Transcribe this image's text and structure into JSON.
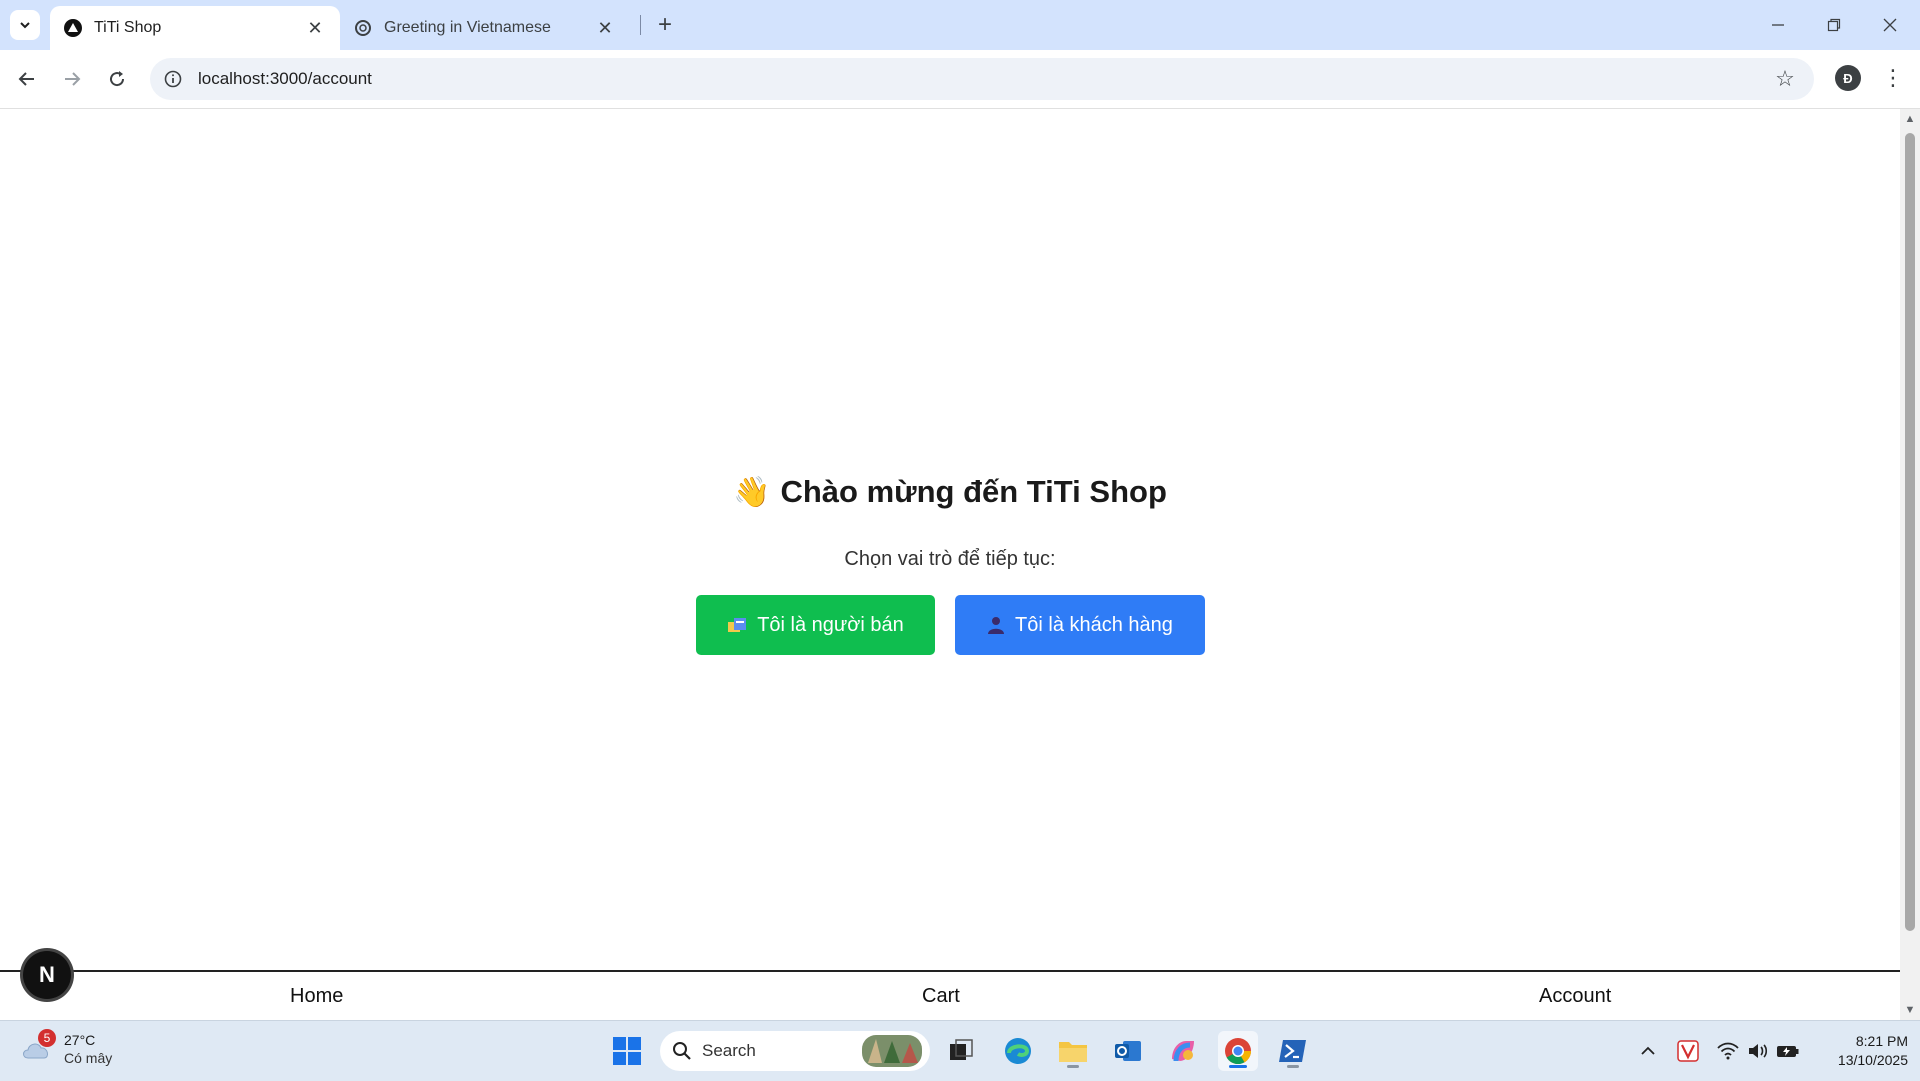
{
  "browser": {
    "tabs": [
      {
        "title": "TiTi Shop",
        "active": true,
        "favicon": "triangle-logo-icon"
      },
      {
        "title": "Greeting in Vietnamese",
        "active": false,
        "favicon": "chatgpt-logo-icon"
      }
    ],
    "url": "localhost:3000/account",
    "profile_initial": "Đ"
  },
  "page": {
    "heading_emoji": "👋",
    "heading": "Chào mừng đến TiTi Shop",
    "subtitle": "Chọn vai trò để tiếp tục:",
    "seller_button": "Tôi là người bán",
    "customer_button": "Tôi là khách hàng",
    "nav": {
      "home": "Home",
      "cart": "Cart",
      "account": "Account"
    },
    "dev_badge": "N",
    "colors": {
      "seller": "#0fbe4f",
      "customer": "#2f7cf6"
    }
  },
  "taskbar": {
    "weather_badge": "5",
    "temperature": "27°C",
    "condition": "Có mây",
    "search_label": "Search",
    "time": "8:21 PM",
    "date": "13/10/2025"
  }
}
